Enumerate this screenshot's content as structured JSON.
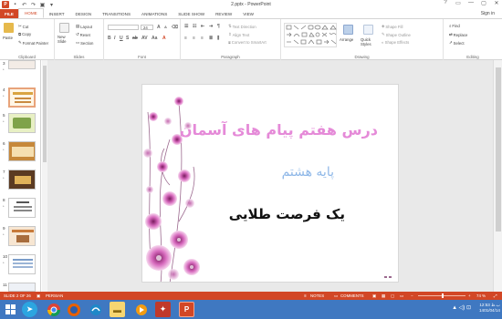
{
  "window": {
    "title": "2.pptx - PowerPoint",
    "controls": [
      "?",
      "▭",
      "—",
      "▢",
      "✕"
    ]
  },
  "tabs": [
    "FILE",
    "HOME",
    "INSERT",
    "DESIGN",
    "TRANSITIONS",
    "ANIMATIONS",
    "SLIDE SHOW",
    "REVIEW",
    "VIEW"
  ],
  "active_tab": "HOME",
  "sign_in": "Sign in",
  "ribbon": {
    "clipboard": {
      "paste": "Paste",
      "cut": "Cut",
      "copy": "Copy",
      "format_painter": "Format Painter",
      "label": "Clipboard"
    },
    "slides": {
      "new_slide": "New Slide",
      "layout": "Layout",
      "reset": "Reset",
      "section": "Section",
      "label": "Slides"
    },
    "font": {
      "font_size": "24",
      "label": "Font"
    },
    "paragraph": {
      "text_direction": "Text Direction",
      "align_text": "Align Text",
      "convert_smartart": "Convert to SmartArt",
      "label": "Paragraph"
    },
    "drawing": {
      "arrange": "Arrange",
      "quick_styles": "Quick Styles",
      "shape_fill": "Shape Fill",
      "shape_outline": "Shape Outline",
      "shape_effects": "Shape Effects",
      "label": "Drawing"
    },
    "editing": {
      "find": "Find",
      "replace": "Replace",
      "select": "Select",
      "label": "Editing"
    }
  },
  "thumbnails": [
    {
      "num": "3",
      "star": "*"
    },
    {
      "num": "4",
      "star": "*"
    },
    {
      "num": "5",
      "star": "*"
    },
    {
      "num": "6",
      "star": "*"
    },
    {
      "num": "7",
      "star": "*"
    },
    {
      "num": "8",
      "star": "*"
    },
    {
      "num": "9",
      "star": "*"
    },
    {
      "num": "10",
      "star": "*"
    },
    {
      "num": "11",
      "star": ""
    }
  ],
  "slide": {
    "title": "درس هفتم پیام های آسمان",
    "subtitle": "پایه هشتم",
    "tagline": "یک فرصت طلایی"
  },
  "status": {
    "slide_info": "SLIDE 2 OF 26",
    "language": "PERSIAN",
    "notes": "NOTES",
    "comments": "COMMENTS",
    "zoom": "74 %"
  },
  "taskbar": {
    "apps": [
      "windows-start",
      "telegram",
      "chrome",
      "firefox",
      "file-explorer",
      "media-player",
      "acrobat",
      "powerpoint"
    ],
    "time": "12:53 ب.ظ",
    "date": "1401/04/14"
  },
  "colors": {
    "accent": "#d24726",
    "taskbar": "#3f78c1",
    "slide_title": "#e58ad8",
    "slide_subtitle": "#8fb8e8"
  }
}
